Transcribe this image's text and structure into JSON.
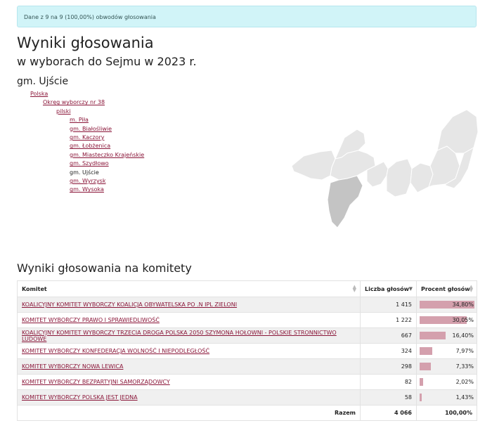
{
  "alert": "Dane z 9 na 9 (100,00%) obwodów głosowania",
  "title": "Wyniki głosowania",
  "subtitle": "w wyborach do Sejmu w 2023 r.",
  "area": "gm. Ujście",
  "tree": {
    "level1": "Polska",
    "level2": "Okręg wyborczy nr 38",
    "level3": "pilski",
    "items": [
      {
        "label": "m. Piła",
        "link": true
      },
      {
        "label": "gm. Białośliwie",
        "link": true
      },
      {
        "label": "gm. Kaczory",
        "link": true
      },
      {
        "label": "gm. Łobżenica",
        "link": true
      },
      {
        "label": "gm. Miasteczko Krajeńskie",
        "link": true
      },
      {
        "label": "gm. Szydłowo",
        "link": true
      },
      {
        "label": "gm. Ujście",
        "link": false
      },
      {
        "label": "gm. Wyrzysk",
        "link": true
      },
      {
        "label": "gm. Wysoka",
        "link": true
      }
    ]
  },
  "map": {
    "fill": "#e6e6e6",
    "selected_fill": "#c4c4c4"
  },
  "results": {
    "heading": "Wyniki głosowania na komitety",
    "headers": {
      "committee": "Komitet",
      "votes": "Liczba głosów",
      "percent": "Procent głosów"
    },
    "rows": [
      {
        "name": "KOALICYJNY KOMITET WYBORCZY KOALICJA OBYWATELSKA PO .N IPL ZIELONI",
        "votes": "1 415",
        "percent": "34,80%",
        "value": 34.8
      },
      {
        "name": "KOMITET WYBORCZY PRAWO I SPRAWIEDLIWOŚĆ",
        "votes": "1 222",
        "percent": "30,05%",
        "value": 30.05
      },
      {
        "name": "KOALICYJNY KOMITET WYBORCZY TRZECIA DROGA POLSKA 2050 SZYMONA HOŁOWNI - POLSKIE STRONNICTWO LUDOWE",
        "votes": "667",
        "percent": "16,40%",
        "value": 16.4
      },
      {
        "name": "KOMITET WYBORCZY KONFEDERACJA WOLNOŚĆ I NIEPODLEGŁOŚĆ",
        "votes": "324",
        "percent": "7,97%",
        "value": 7.97
      },
      {
        "name": "KOMITET WYBORCZY NOWA LEWICA",
        "votes": "298",
        "percent": "7,33%",
        "value": 7.33
      },
      {
        "name": "KOMITET WYBORCZY BEZPARTYJNI SAMORZĄDOWCY",
        "votes": "82",
        "percent": "2,02%",
        "value": 2.02
      },
      {
        "name": "KOMITET WYBORCZY POLSKA JEST JEDNA",
        "votes": "58",
        "percent": "1,43%",
        "value": 1.43
      }
    ],
    "total_label": "Razem",
    "total_votes": "4 066",
    "total_percent": "100,00%",
    "bar_color": "#d4a0ad"
  }
}
